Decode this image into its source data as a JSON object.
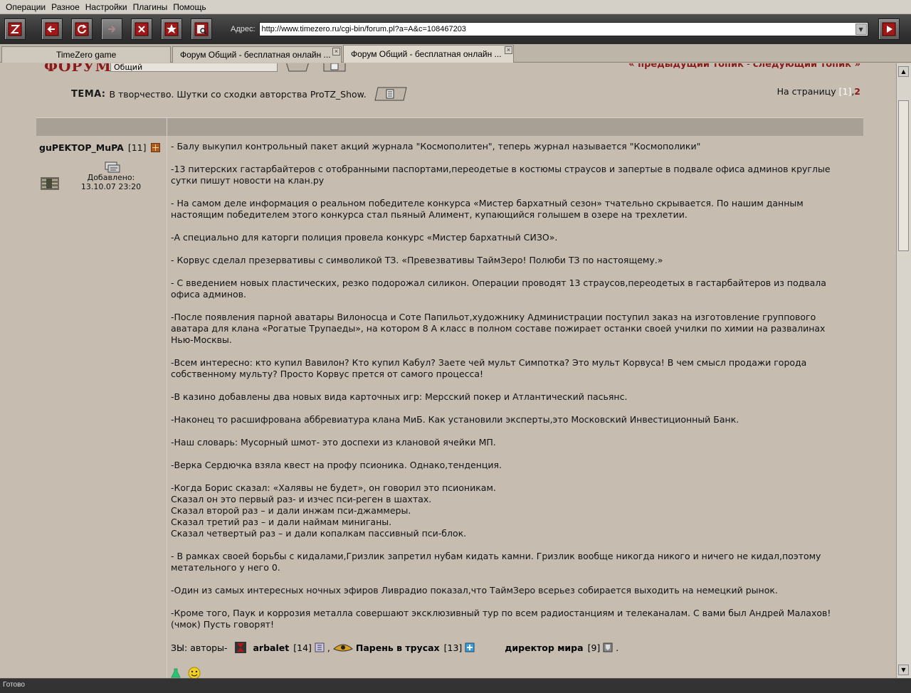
{
  "menu": [
    "Операции",
    "Разное",
    "Настройки",
    "Плагины",
    "Помощь"
  ],
  "address": {
    "label": "Адрес:",
    "url": "http://www.timezero.ru/cgi-bin/forum.pl?a=A&c=108467203"
  },
  "tabs": [
    {
      "label": "TimeZero game"
    },
    {
      "label": "Форум Общий - бесплатная онлайн ..."
    },
    {
      "label": "Форум Общий - бесплатная онлайн ..."
    }
  ],
  "forum": {
    "title": "ФОРУМ:",
    "section_value": "Общий",
    "prev_topic": "« предыдущий топик",
    "nav_separator": " - ",
    "next_topic": "следующий топик »",
    "tema_label": "ТЕМА:",
    "tema_text": "В творчество. Шутки со сходки авторства ProTZ_Show.",
    "pages_label": "На страницу",
    "page_current": "[1]",
    "page_comma": ",",
    "page_next": "2"
  },
  "post": {
    "author": "guPEKTOP_MuPA",
    "author_level": "[11]",
    "added_label": "Добавлено:",
    "added_date": "13.10.07 23:20",
    "paragraphs": [
      [
        "- Балу выкупил контрольный пакет акций журнала \"Космополитен\", теперь журнал называется \"Космополики\""
      ],
      [
        "-13 питерских гастарбайтеров с отобранными паспортами,переодетые в костюмы страусов и запертые в подвале офиса админов круглые",
        "сутки пишут новости на клан.ру"
      ],
      [
        "- На самом деле информация о реальном победителе конкурса «Мистер бархатный сезон» тчательно скрывается. По нашим данным",
        "настоящим победителем этого конкурса стал пьяный Алимент, купающийся голышем в озере на трехлетии."
      ],
      [
        "-А специально для каторги полиция провела конкурс «Мистер бархатный СИЗО»."
      ],
      [
        "- Корвус сделал презервативы с символикой ТЗ. «Превезвативы ТаймЗеро! Полюби ТЗ по настоящему.»"
      ],
      [
        "- С введением новых пластических, резко подорожал силикон. Операции проводят 13 страусов,переодетых в гастарбайтеров из подвала",
        "офиса админов."
      ],
      [
        "-После появления парной аватары Вилоносца и Соте Папильот,художнику Администрации поступил заказ на изготовление группового",
        "аватара для клана «Рогатые Трупаеды», на котором 8 А класс в полном составе пожирает останки своей училки по химии на развалинах",
        "Нью-Москвы."
      ],
      [
        "-Всем интересно: кто купил Вавилон? Кто купил Кабул? Заете чей мульт Симпотка? Это мульт Корвуса! В чем смысл продажи города",
        "собственному мульту? Просто Корвус прется от самого процесса!"
      ],
      [
        "-В казино добавлены два новых вида карточных игр: Мерсский покер и Атлантический пасьянс."
      ],
      [
        "-Наконец то расшифрована аббревиатура клана МиБ. Как установили эксперты,это Московский Инвестиционный Банк."
      ],
      [
        "-Наш словарь: Мусорный шмот- это доспехи из клановой ячейки МП."
      ],
      [
        "-Верка Сердючка взяла квест на профу псионика. Однако,тенденция."
      ],
      [
        "-Когда Борис сказал: «Халявы не будет», он говорил это псионикам.",
        "Сказал он это первый раз- и изчес пси-реген в шахтах.",
        "Сказал второй раз – и дали инжам пси-джаммеры.",
        "Сказал третий раз – и дали наймам миниганы.",
        "Сказал четвертый раз – и дали копалкам пассивный пси-блок."
      ],
      [
        "- В рамках своей борьбы с кидалами,Гризлик запретил нубам кидать камни. Гризлик вообще никогда никого и ничего не кидал,поэтому",
        "метательного у него 0."
      ],
      [
        "-Один из самых интересных ночных эфиров Ливрадио показал,что ТаймЗеро всерьез собирается выходить на немецкий рынок."
      ],
      [
        "-Кроме того, Паук и коррозия металла совершают эксклюзивный тур по всем радиостанциям и телеканалам. С вами был Андрей Малахов!",
        "(чмок) Пусть говорят!"
      ]
    ],
    "ps_prefix": "ЗЫ: авторы-",
    "ps_authors": [
      {
        "nick": "arbalet",
        "level": "[14]",
        "sep": ","
      },
      {
        "nick": "Парень в трусах",
        "level": "[13]",
        "sep": ""
      },
      {
        "nick": "директор мира",
        "level": "[9]",
        "sep": "."
      }
    ]
  },
  "status": "Готово",
  "colors": {
    "page_bg": "#c6bdb0",
    "forum_red": "#8b1a1a",
    "header_bar": "#a8a094",
    "toolbar_dark": "#333333"
  }
}
